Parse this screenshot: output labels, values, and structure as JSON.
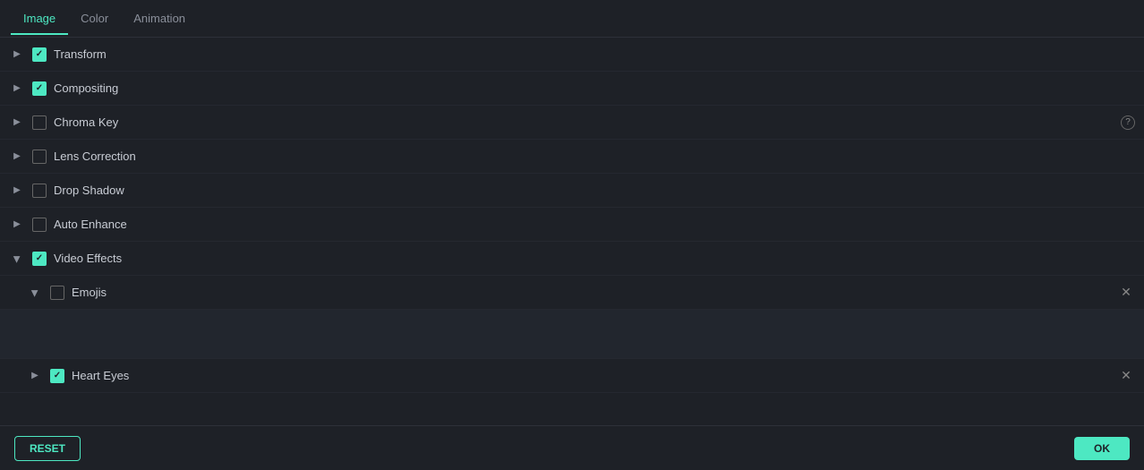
{
  "tabs": [
    {
      "label": "Image",
      "active": true
    },
    {
      "label": "Color",
      "active": false
    },
    {
      "label": "Animation",
      "active": false
    }
  ],
  "rows": [
    {
      "id": "transform",
      "label": "Transform",
      "checked": true,
      "chevron": "right",
      "indent": 0,
      "hasHelp": false,
      "hasClose": false
    },
    {
      "id": "compositing",
      "label": "Compositing",
      "checked": true,
      "chevron": "right",
      "indent": 0,
      "hasHelp": false,
      "hasClose": false
    },
    {
      "id": "chroma-key",
      "label": "Chroma Key",
      "checked": false,
      "chevron": "right",
      "indent": 0,
      "hasHelp": true,
      "hasClose": false
    },
    {
      "id": "lens-correction",
      "label": "Lens Correction",
      "checked": false,
      "chevron": "right",
      "indent": 0,
      "hasHelp": false,
      "hasClose": false
    },
    {
      "id": "drop-shadow",
      "label": "Drop Shadow",
      "checked": false,
      "chevron": "right",
      "indent": 0,
      "hasHelp": false,
      "hasClose": false
    },
    {
      "id": "auto-enhance",
      "label": "Auto Enhance",
      "checked": false,
      "chevron": "right",
      "indent": 0,
      "hasHelp": false,
      "hasClose": false
    },
    {
      "id": "video-effects",
      "label": "Video Effects",
      "checked": true,
      "chevron": "down",
      "indent": 0,
      "hasHelp": false,
      "hasClose": false
    },
    {
      "id": "emojis",
      "label": "Emojis",
      "checked": false,
      "chevron": "down",
      "indent": 1,
      "hasHelp": false,
      "hasClose": true
    },
    {
      "id": "heart-eyes",
      "label": "Heart Eyes",
      "checked": true,
      "chevron": "right",
      "indent": 1,
      "hasHelp": false,
      "hasClose": true
    }
  ],
  "footer": {
    "reset_label": "RESET",
    "ok_label": "OK"
  }
}
